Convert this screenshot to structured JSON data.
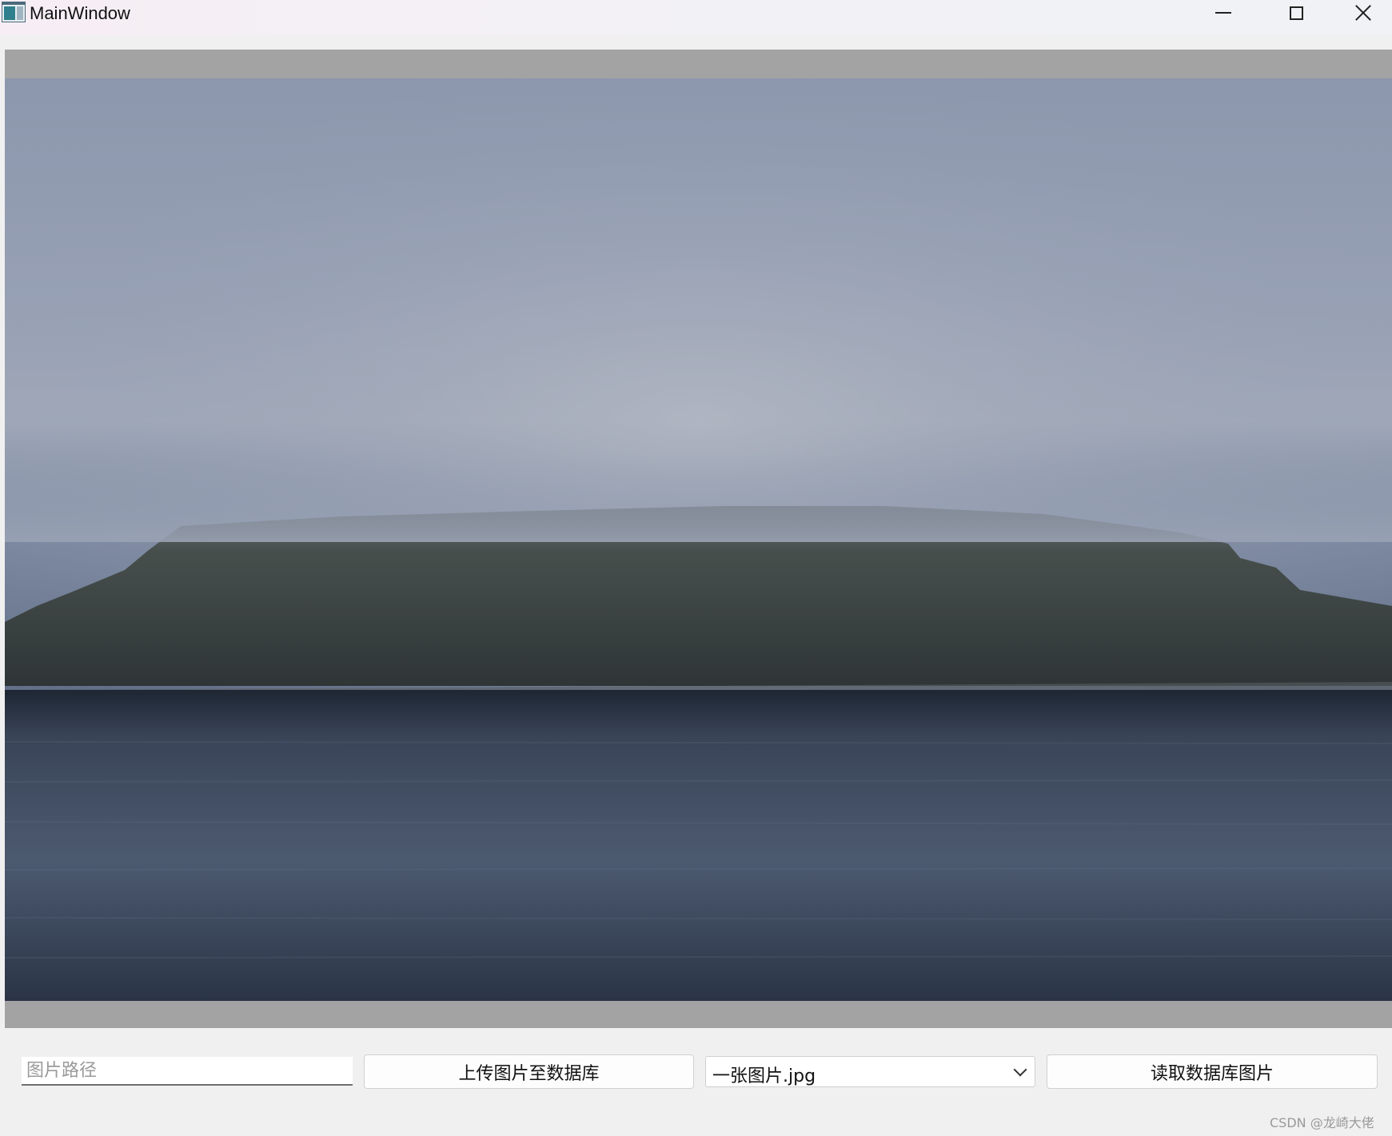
{
  "window": {
    "title": "MainWindow",
    "controls": [
      "minimize-icon",
      "maximize-icon",
      "close-icon"
    ]
  },
  "image_view": {
    "frame_color": "#a3a3a3",
    "content": "landscape-photo-foggy-island"
  },
  "controls": {
    "path_input": {
      "placeholder": "图片路径",
      "value": ""
    },
    "upload_button": "上传图片至数据库",
    "image_select": {
      "selected": "一张图片.jpg"
    },
    "read_button": "读取数据库图片"
  },
  "watermark": "CSDN @龙崎大佬"
}
